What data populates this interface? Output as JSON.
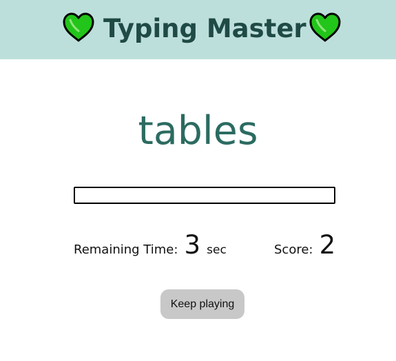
{
  "header": {
    "title": "Typing Master",
    "left_icon": "green-heart-icon",
    "right_icon": "green-heart-icon",
    "background_color": "#bddfdb",
    "title_color": "#1f4a45",
    "heart_color": "#22c51a"
  },
  "game": {
    "current_word": "tables",
    "word_color": "#2c6b61",
    "input": {
      "value": "",
      "placeholder": ""
    },
    "remaining_time": {
      "label": "Remaining Time:",
      "value": "3",
      "unit": "sec"
    },
    "score": {
      "label": "Score:",
      "value": "2"
    },
    "keep_playing_label": "Keep playing"
  }
}
